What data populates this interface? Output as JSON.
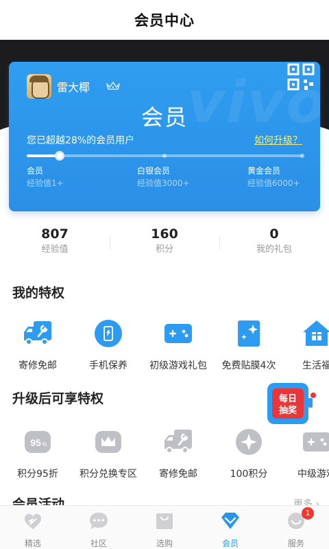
{
  "header": {
    "title": "会员中心"
  },
  "card": {
    "watermark": "vivo",
    "username": "雷大椰",
    "level": "会员",
    "exceed_text": "您已超越28%的会员用户",
    "upgrade_link": "如何升级？",
    "progress": 0.12,
    "tiers": [
      {
        "name": "会员",
        "requirement": "经验值1+"
      },
      {
        "name": "白银会员",
        "requirement": "经验值3000+"
      },
      {
        "name": "黄金会员",
        "requirement": "经验值6000+"
      }
    ]
  },
  "stats": [
    {
      "value": "807",
      "label": "经验值"
    },
    {
      "value": "160",
      "label": "积分"
    },
    {
      "value": "0",
      "label": "我的礼包"
    }
  ],
  "my_privileges": {
    "title": "我的特权",
    "items": [
      {
        "label": "寄修免邮",
        "icon": "repair-truck-icon"
      },
      {
        "label": "手机保养",
        "icon": "phone-care-icon"
      },
      {
        "label": "初级游戏礼包",
        "icon": "gamepad-icon"
      },
      {
        "label": "免费贴膜4次",
        "icon": "screen-film-icon"
      },
      {
        "label": "生活福",
        "icon": "gift-house-icon"
      }
    ]
  },
  "upgrade_privileges": {
    "title": "升级后可享特权",
    "items": [
      {
        "label": "积分95折",
        "icon": "discount-95-icon",
        "icon_text": "95",
        "icon_suffix": "%"
      },
      {
        "label": "积分兑换专区",
        "icon": "crown-exchange-icon"
      },
      {
        "label": "寄修免邮",
        "icon": "repair-truck-icon"
      },
      {
        "label": "100积分",
        "icon": "points-star-icon"
      },
      {
        "label": "中级游戏",
        "icon": "gamepad-icon"
      }
    ]
  },
  "lottery": {
    "line1": "每日",
    "line2": "抽奖"
  },
  "activities": {
    "title": "会员活动",
    "more": "更多 ›"
  },
  "bottom_nav": [
    {
      "label": "精选",
      "icon": "heart-icon"
    },
    {
      "label": "社区",
      "icon": "chat-icon"
    },
    {
      "label": "选购",
      "icon": "shopping-bag-icon"
    },
    {
      "label": "会员",
      "icon": "diamond-icon",
      "active": true
    },
    {
      "label": "服务",
      "icon": "smile-icon",
      "badge": "1"
    }
  ],
  "colors": {
    "accent": "#2b95ec",
    "card": "#2f9df0",
    "link": "#f5ef76",
    "badge": "#f0382d"
  }
}
